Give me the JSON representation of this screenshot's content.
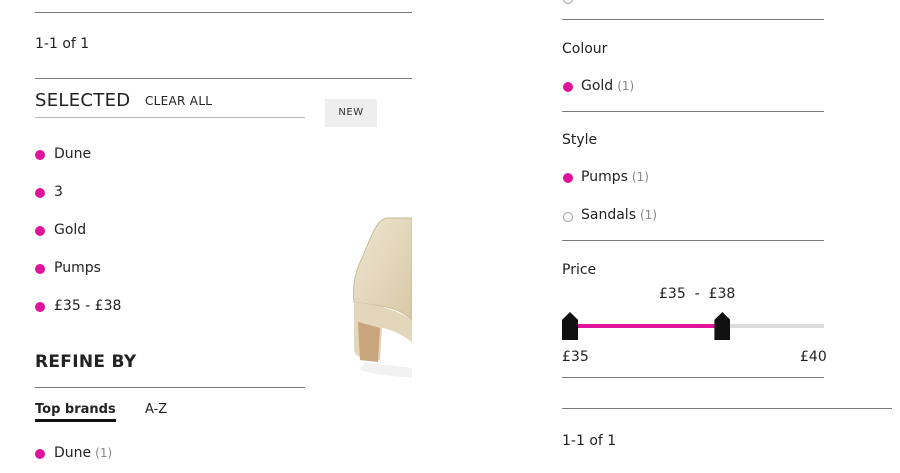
{
  "left": {
    "results_count": "1-1 of 1",
    "selected_heading": "SELECTED",
    "clear_all": "CLEAR ALL",
    "new_badge": "NEW",
    "selected_filters": [
      "Dune",
      "3",
      "Gold",
      "Pumps",
      "£35 - £38"
    ],
    "refine_heading": "REFINE BY",
    "tabs": [
      "Top brands",
      "A-Z"
    ],
    "brand_items": [
      {
        "label": "Dune",
        "count": "(1)"
      }
    ]
  },
  "right": {
    "colour_heading": "Colour",
    "colour_items": [
      {
        "label": "Gold",
        "count": "(1)",
        "selected": true
      }
    ],
    "style_heading": "Style",
    "style_items": [
      {
        "label": "Pumps",
        "count": "(1)",
        "selected": true
      },
      {
        "label": "Sandals",
        "count": "(1)",
        "selected": false
      }
    ],
    "price_heading": "Price",
    "price_range_label": "£35  -  £38",
    "price_min_label": "£35",
    "price_max_label": "£40",
    "price_slider": {
      "min": 35,
      "max": 40,
      "low": 35,
      "high": 38
    },
    "results_count": "1-1 of 1"
  },
  "colors": {
    "accent": "#e0119a",
    "track": "#dddddd",
    "handle": "#111111"
  }
}
